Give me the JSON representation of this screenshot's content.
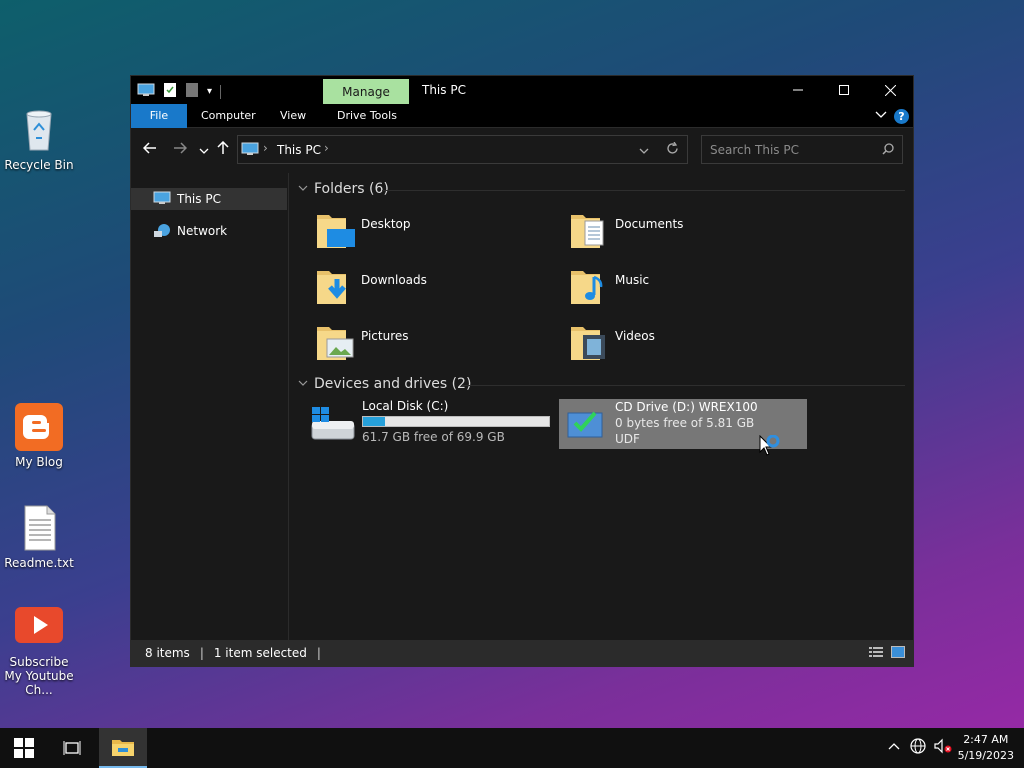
{
  "desktop": {
    "icons": [
      {
        "label": "Recycle Bin",
        "icon": "recycle-bin-icon"
      },
      {
        "label": "My Blog",
        "icon": "blogger-icon"
      },
      {
        "label": "Readme.txt",
        "icon": "text-file-icon"
      },
      {
        "label": "Subscribe My Youtube Ch...",
        "icon": "youtube-icon"
      }
    ]
  },
  "window": {
    "title": "This PC",
    "contextual_tab": "Manage",
    "ribbon_tabs": [
      "File",
      "Computer",
      "View",
      "Drive Tools"
    ],
    "help": "?",
    "address": {
      "root": "This PC"
    },
    "search": {
      "placeholder": "Search This PC"
    },
    "sidebar": {
      "items": [
        {
          "label": "This PC",
          "icon": "computer-icon",
          "selected": true
        },
        {
          "label": "Network",
          "icon": "network-icon",
          "selected": false
        }
      ]
    },
    "folders_group": {
      "title": "Folders (6)"
    },
    "folders": [
      {
        "name": "Desktop",
        "icon": "desktop-folder-icon"
      },
      {
        "name": "Documents",
        "icon": "documents-folder-icon"
      },
      {
        "name": "Downloads",
        "icon": "downloads-folder-icon"
      },
      {
        "name": "Music",
        "icon": "music-folder-icon"
      },
      {
        "name": "Pictures",
        "icon": "pictures-folder-icon"
      },
      {
        "name": "Videos",
        "icon": "videos-folder-icon"
      }
    ],
    "drives_group": {
      "title": "Devices and drives (2)"
    },
    "drives": [
      {
        "name": "Local Disk (C:)",
        "free": "61.7 GB free of 69.9 GB",
        "used_fraction": 0.12,
        "icon": "windows-drive-icon"
      },
      {
        "name": "CD Drive (D:) WREX100",
        "free": "0 bytes free of 5.81 GB",
        "fs": "UDF",
        "icon": "cd-drive-icon",
        "selected": true
      }
    ],
    "status": {
      "items": "8 items",
      "selected": "1 item selected"
    }
  },
  "taskbar": {
    "time": "2:47 AM",
    "date": "5/19/2023"
  },
  "colors": {
    "accent": "#1979ca",
    "manage_tab": "#a9e1a0",
    "progress": "#26a0da"
  }
}
